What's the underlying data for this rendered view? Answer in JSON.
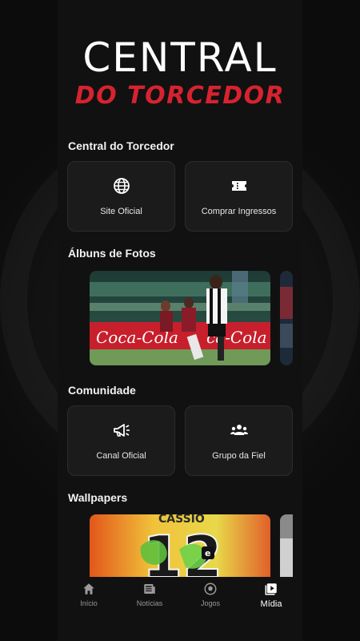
{
  "header": {
    "title_line1": "CENTRAL",
    "title_line2": "DO TORCEDOR"
  },
  "sections": {
    "central": {
      "title": "Central do Torcedor",
      "cards": [
        {
          "label": "Site Oficial",
          "icon": "globe-icon"
        },
        {
          "label": "Comprar Ingressos",
          "icon": "ticket-icon"
        }
      ]
    },
    "albums": {
      "title": "Álbuns de Fotos"
    },
    "community": {
      "title": "Comunidade",
      "cards": [
        {
          "label": "Canal Oficial",
          "icon": "megaphone-icon"
        },
        {
          "label": "Grupo da Fiel",
          "icon": "group-icon"
        }
      ]
    },
    "wallpapers": {
      "title": "Wallpapers",
      "jersey_name": "CÁSSIO",
      "jersey_number": "12"
    }
  },
  "nav": {
    "items": [
      {
        "label": "Início",
        "icon": "home-icon"
      },
      {
        "label": "Notícias",
        "icon": "news-icon"
      },
      {
        "label": "Jogos",
        "icon": "ball-icon"
      },
      {
        "label": "Mídia",
        "icon": "media-icon",
        "active": true
      }
    ]
  },
  "colors": {
    "accent_red": "#d6232f",
    "background": "#0c0c0c",
    "card": "#1b1b1b"
  }
}
